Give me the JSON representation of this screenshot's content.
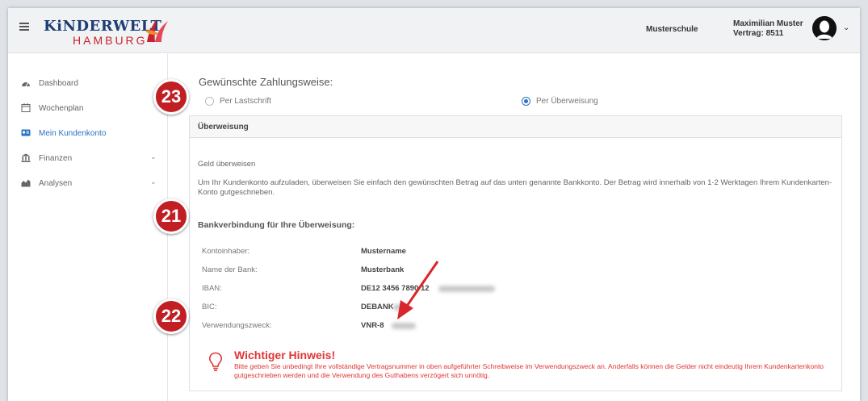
{
  "header": {
    "logo_top": "KiNDERWELT",
    "logo_bottom": "HAMBURG",
    "school": "Musterschule",
    "user_name": "Maximilian Muster",
    "contract": "Vertrag: 8511"
  },
  "sidebar": {
    "items": [
      {
        "label": "Dashboard",
        "icon": "dashboard-icon"
      },
      {
        "label": "Wochenplan",
        "icon": "calendar-icon"
      },
      {
        "label": "Mein Kundenkonto",
        "icon": "id-card-icon",
        "active": true
      },
      {
        "label": "Finanzen",
        "icon": "bank-icon",
        "expandable": true
      },
      {
        "label": "Analysen",
        "icon": "chart-icon",
        "expandable": true
      }
    ]
  },
  "main": {
    "section_title": "Gewünschte Zahlungsweise:",
    "payment_options": [
      {
        "label": "Per Lastschrift",
        "checked": false
      },
      {
        "label": "Per Überweisung",
        "checked": true
      }
    ],
    "card": {
      "title": "Überweisung",
      "subtitle": "Geld überweisen",
      "intro": "Um Ihr Kundenkonto aufzuladen, überweisen Sie einfach den gewünschten Betrag auf das unten genannte Bankkonto. Der Betrag wird innerhalb von 1-2 Werktagen Ihrem Kundenkarten-Konto gutgeschrieben.",
      "bank_title": "Bankverbindung für Ihre Überweisung:",
      "rows": [
        {
          "label": "Kontoinhaber:",
          "value": "Mustername"
        },
        {
          "label": "Name der Bank:",
          "value": "Musterbank"
        },
        {
          "label": "IBAN:",
          "value": "DE12 3456 7890 12"
        },
        {
          "label": "BIC:",
          "value": "DEBANK"
        },
        {
          "label": "Verwendungszweck:",
          "value": "VNR-8"
        }
      ],
      "notice_title": "Wichtiger Hinweis!",
      "notice_text": "Bitte geben Sie unbedingt Ihre vollständige Vertragsnummer in oben aufgeführter Schreibweise im Verwendungszweck an. Anderfalls können die Gelder nicht eindeutig Ihrem Kundenkartenkonto gutgeschrieben werden und die Verwendung des Guthabens verzögert sich unnötig."
    }
  },
  "badges": [
    "23",
    "21",
    "22"
  ],
  "colors": {
    "accent": "#2b73c2",
    "badge": "#c11f24",
    "warning": "#e03535",
    "logo_blue": "#1e3e73",
    "logo_red": "#c8232c"
  }
}
